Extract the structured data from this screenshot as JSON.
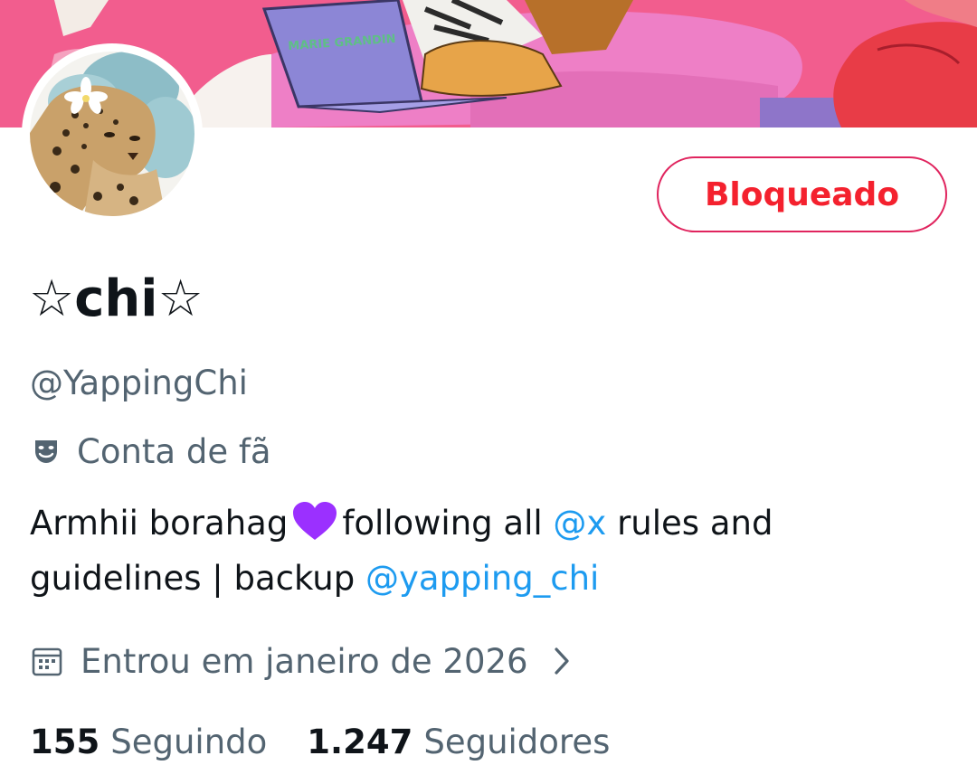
{
  "banner": {
    "laptop_sticker_text": "MARIE GRANDIN",
    "colors": {
      "pink": "#f25d8e",
      "sofa": "#ee7fc6",
      "laptop": "#8c86d6"
    }
  },
  "profile": {
    "display_name": "☆chi☆",
    "handle": "@YappingChi",
    "label_icon": "theater-masks-icon",
    "label": "Conta de fã",
    "block_button_label": "Bloqueado",
    "bio": {
      "line1_part1": "Armhii borahag",
      "emoji": "purple-heart",
      "line1_part2": "following all",
      "mention1": "@x",
      "line1_part3": "rules and",
      "line2_part1": "guidelines | backup",
      "mention2": "@yapping_chi"
    },
    "joined_icon": "calendar-icon",
    "joined": "Entrou em janeiro de 2026",
    "following_count": "155",
    "following_label": "Seguindo",
    "followers_count": "1.247",
    "followers_label": "Seguidores"
  },
  "colors": {
    "primary_text": "#0f1419",
    "secondary_text": "#536471",
    "link": "#1d9bf0",
    "danger": "#f4212e",
    "heart": "#9b30ff"
  }
}
